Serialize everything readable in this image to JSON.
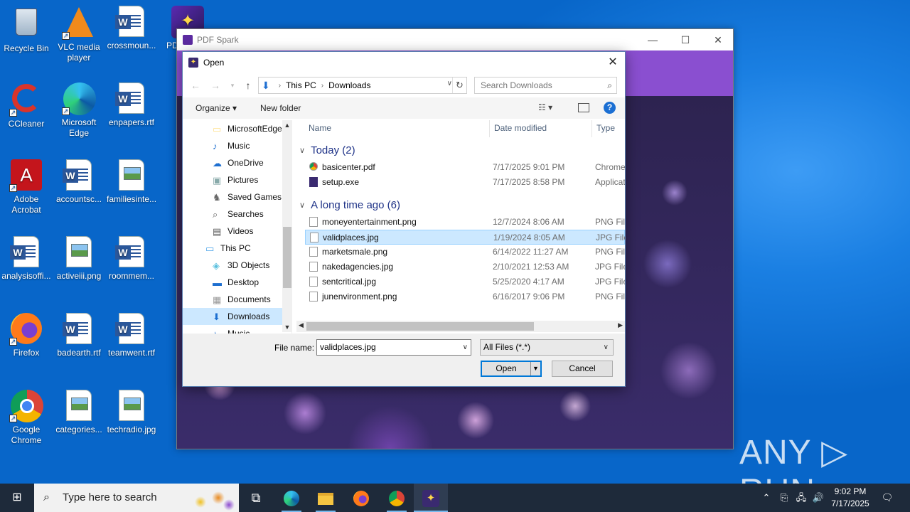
{
  "desktop": {
    "icons": [
      {
        "label": "Recycle Bin"
      },
      {
        "label": "VLC media player"
      },
      {
        "label": "crossmoun..."
      },
      {
        "label": "PD"
      },
      {
        "label": "CCleaner"
      },
      {
        "label": "Microsoft Edge"
      },
      {
        "label": "enpapers.rtf"
      },
      {
        "label": "Adobe Acrobat"
      },
      {
        "label": "accountsc..."
      },
      {
        "label": "familiesinte..."
      },
      {
        "label": "analysisoffi..."
      },
      {
        "label": "activeiii.png"
      },
      {
        "label": "roommem..."
      },
      {
        "label": "Firefox"
      },
      {
        "label": "badearth.rtf"
      },
      {
        "label": "teamwent.rtf"
      },
      {
        "label": "Google Chrome"
      },
      {
        "label": "categories..."
      },
      {
        "label": "techradio.jpg"
      }
    ]
  },
  "app_window": {
    "title": "PDF Spark",
    "min_icon": "—",
    "max_icon": "☐",
    "close_icon": "✕"
  },
  "dialog": {
    "title": "Open",
    "close_icon": "✕",
    "address": {
      "crumbs": [
        "This PC",
        "Downloads"
      ]
    },
    "search_placeholder": "Search Downloads",
    "toolbar": {
      "organize": "Organize ▾",
      "new_folder": "New folder",
      "help": "?"
    },
    "nav_items": [
      {
        "label": "MicrosoftEdge",
        "icon": "folder-icon",
        "color": "#ffe08a"
      },
      {
        "label": "Music",
        "icon": "music-icon",
        "color": "#1e6fd0"
      },
      {
        "label": "OneDrive",
        "icon": "cloud-icon",
        "color": "#1e6fd0"
      },
      {
        "label": "Pictures",
        "icon": "pictures-icon",
        "color": "#8aa"
      },
      {
        "label": "Saved Games",
        "icon": "saved-games-icon",
        "color": "#666"
      },
      {
        "label": "Searches",
        "icon": "searches-icon",
        "color": "#666"
      },
      {
        "label": "Videos",
        "icon": "videos-icon",
        "color": "#555"
      },
      {
        "label": "This PC",
        "icon": "computer-icon",
        "color": "#4aa3e8"
      },
      {
        "label": "3D Objects",
        "icon": "objects-3d-icon",
        "color": "#5bc0de"
      },
      {
        "label": "Desktop",
        "icon": "desktop-icon",
        "color": "#1e6fd0"
      },
      {
        "label": "Documents",
        "icon": "documents-icon",
        "color": "#999"
      },
      {
        "label": "Downloads",
        "icon": "downloads-icon",
        "color": "#1e6fd0"
      },
      {
        "label": "Music",
        "icon": "music-icon",
        "color": "#1e6fd0"
      }
    ],
    "columns": {
      "name": "Name",
      "date": "Date modified",
      "type": "Type"
    },
    "groups": [
      {
        "label": "Today (2)",
        "files": [
          {
            "name": "basicenter.pdf",
            "date": "7/17/2025 9:01 PM",
            "type": "Chrome"
          },
          {
            "name": "setup.exe",
            "date": "7/17/2025 8:58 PM",
            "type": "Applicat"
          }
        ]
      },
      {
        "label": "A long time ago (6)",
        "files": [
          {
            "name": "moneyentertainment.png",
            "date": "12/7/2024 8:06 AM",
            "type": "PNG File"
          },
          {
            "name": "validplaces.jpg",
            "date": "1/19/2024 8:05 AM",
            "type": "JPG File"
          },
          {
            "name": "marketsmale.png",
            "date": "6/14/2022 11:27 AM",
            "type": "PNG File"
          },
          {
            "name": "nakedagencies.jpg",
            "date": "2/10/2021 12:53 AM",
            "type": "JPG File"
          },
          {
            "name": "sentcritical.jpg",
            "date": "5/25/2020 4:17 AM",
            "type": "JPG File"
          },
          {
            "name": "junenvironment.png",
            "date": "6/16/2017 9:06 PM",
            "type": "PNG File"
          }
        ]
      }
    ],
    "filename_label": "File name:",
    "filename_value": "validplaces.jpg",
    "filetype_value": "All Files (*.*)",
    "open_label": "Open",
    "cancel_label": "Cancel"
  },
  "taskbar": {
    "search_placeholder": "Type here to search",
    "time": "9:02 PM",
    "date": "7/17/2025"
  },
  "watermark": "ANY ▷ RUN"
}
